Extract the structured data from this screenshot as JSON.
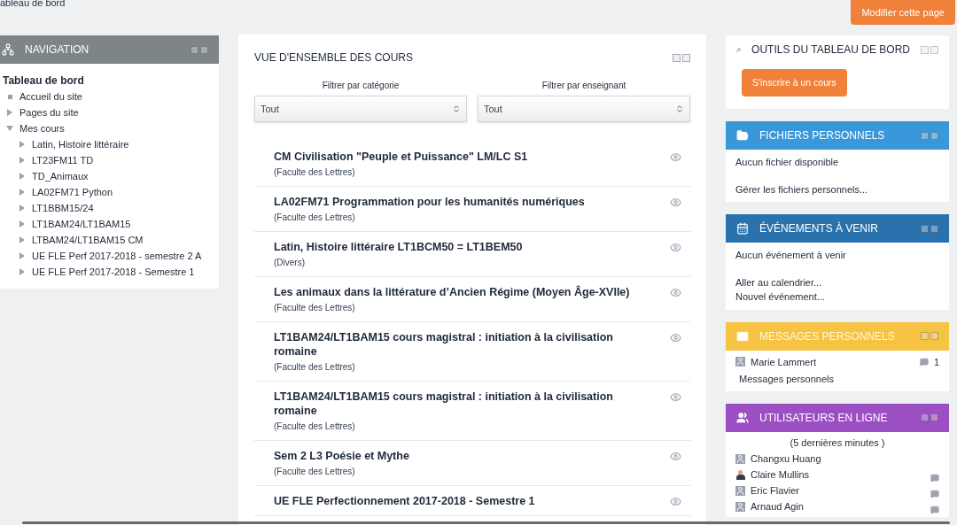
{
  "breadcrumb": "ableau de bord",
  "edit_button": "Modifier cette page",
  "navigation": {
    "title": "NAVIGATION",
    "root": "Tableau de bord",
    "items": [
      {
        "label": "Accueil du site"
      },
      {
        "label": "Pages du site",
        "expanded": false
      },
      {
        "label": "Mes cours",
        "expanded": true,
        "children": [
          {
            "label": "Latin, Histoire littéraire",
            "expanded": false
          },
          {
            "label": "LT23FM11 TD",
            "expanded": false
          },
          {
            "label": "TD_Animaux",
            "expanded": false
          },
          {
            "label": "LA02FM71 Python",
            "expanded": false
          },
          {
            "label": "LT1BBM15/24",
            "expanded": false
          },
          {
            "label": "LT1BAM24/LT1BAM15",
            "expanded": false
          },
          {
            "label": "LTBAM24/LT1BAM15 CM",
            "expanded": false
          },
          {
            "label": "UE FLE Perf 2017-2018 - semestre 2 A",
            "expanded": false
          },
          {
            "label": "UE FLE Perf 2017-2018 - Semestre 1",
            "expanded": false
          }
        ]
      }
    ]
  },
  "overview": {
    "title": "VUE D'ENSEMBLE DES COURS",
    "filters": [
      {
        "label": "Filtrer par catégorie",
        "value": "Tout"
      },
      {
        "label": "Filtrer par enseignant",
        "value": "Tout"
      }
    ],
    "courses": [
      {
        "name": "CM Civilisation \"Peuple et Puissance\" LM/LC S1",
        "category": "(Faculte des Lettres)"
      },
      {
        "name": "LA02FM71 Programmation pour les humanités numériques",
        "category": "(Faculte des Lettres)"
      },
      {
        "name": "Latin, Histoire littéraire LT1BCM50 = LT1BEM50",
        "category": "(Divers)"
      },
      {
        "name": "Les animaux dans la littérature d’Ancien Régime (Moyen Âge-XVIIe)",
        "category": "(Faculte des Lettres)"
      },
      {
        "name": "LT1BAM24/LT1BAM15 cours magistral : initiation à la civilisation romaine",
        "category": "(Faculte des Lettres)"
      },
      {
        "name": "LT1BAM24/LT1BAM15 cours magistral : initiation à la civilisation romaine",
        "category": "(Faculte des Lettres)"
      },
      {
        "name": "Sem 2 L3 Poésie et Mythe",
        "category": "(Faculte des Lettres)"
      },
      {
        "name": "UE FLE Perfectionnement 2017-2018 - Semestre 1"
      }
    ]
  },
  "tools": {
    "title": "OUTILS DU TABLEAU DE BORD",
    "button": "S'inscrire à un cours"
  },
  "files": {
    "title": "FICHIERS PERSONNELS",
    "empty": "Aucun fichier disponible",
    "link": "Gérer les fichiers personnels..."
  },
  "events": {
    "title": "ÉVÉNEMENTS À VENIR",
    "empty": "Aucun événement à venir",
    "links": [
      "Aller au calendrier...",
      "Nouvel événement..."
    ]
  },
  "messages": {
    "title": "MESSAGES PERSONNELS",
    "contacts": [
      {
        "name": "Marie Lammert",
        "count": "1"
      }
    ],
    "link": "Messages personnels"
  },
  "online": {
    "title": "UTILISATEURS EN LIGNE",
    "period": "(5 dernières minutes )",
    "users": [
      {
        "name": "Changxu Huang",
        "kind": "default",
        "message": false
      },
      {
        "name": "Claire Mullins",
        "kind": "photo",
        "message": true
      },
      {
        "name": "Eric Flavier",
        "kind": "default",
        "message": true
      },
      {
        "name": "Arnaud Agin",
        "kind": "default",
        "message": true
      }
    ]
  }
}
